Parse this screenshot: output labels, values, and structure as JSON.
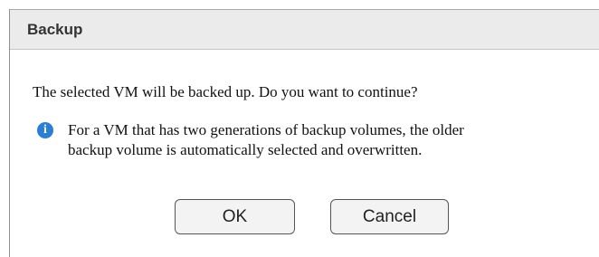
{
  "dialog": {
    "title": "Backup",
    "message": "The selected VM will be backed up. Do you want to continue?",
    "note_icon": "info-icon",
    "note_lines": [
      "For a VM that has two generations of backup volumes, the older",
      "backup volume is automatically selected and overwritten."
    ],
    "ok_label": "OK",
    "cancel_label": "Cancel"
  },
  "colors": {
    "titlebar_bg": "#ebebeb",
    "info_icon": "#2a7fd4",
    "button_bg": "#f3f3f3"
  }
}
